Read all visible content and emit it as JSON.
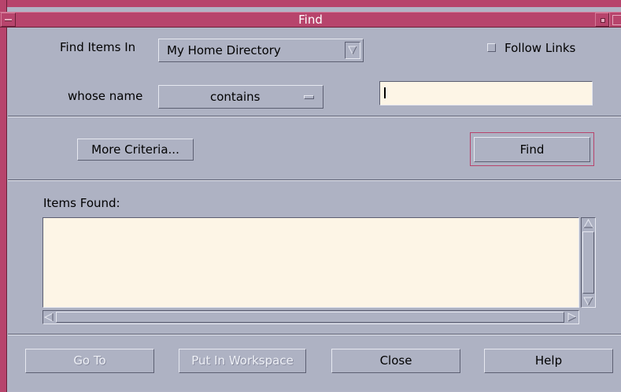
{
  "window": {
    "title": "Find"
  },
  "find_in": {
    "label": "Find Items In",
    "selected": "My Home Directory"
  },
  "follow_links": {
    "label": "Follow Links",
    "checked": false
  },
  "name_filter": {
    "label": "whose name",
    "operator": "contains",
    "value": ""
  },
  "buttons": {
    "more_criteria": "More Criteria...",
    "find": "Find",
    "go_to": "Go To",
    "put_in_workspace": "Put In Workspace",
    "close": "Close",
    "help": "Help"
  },
  "results": {
    "label": "Items Found:",
    "items": []
  },
  "icons": {
    "window_menu": "window-menu-icon",
    "minimize": "minimize-icon",
    "maximize": "maximize-icon",
    "dropdown": "dropdown-arrow-icon",
    "scroll_up": "scroll-up-arrow-icon",
    "scroll_down": "scroll-down-arrow-icon",
    "scroll_left": "scroll-left-arrow-icon",
    "scroll_right": "scroll-right-arrow-icon"
  },
  "colors": {
    "accent": "#b7446c",
    "background": "#aeb2c3",
    "field": "#fdf5e6"
  }
}
